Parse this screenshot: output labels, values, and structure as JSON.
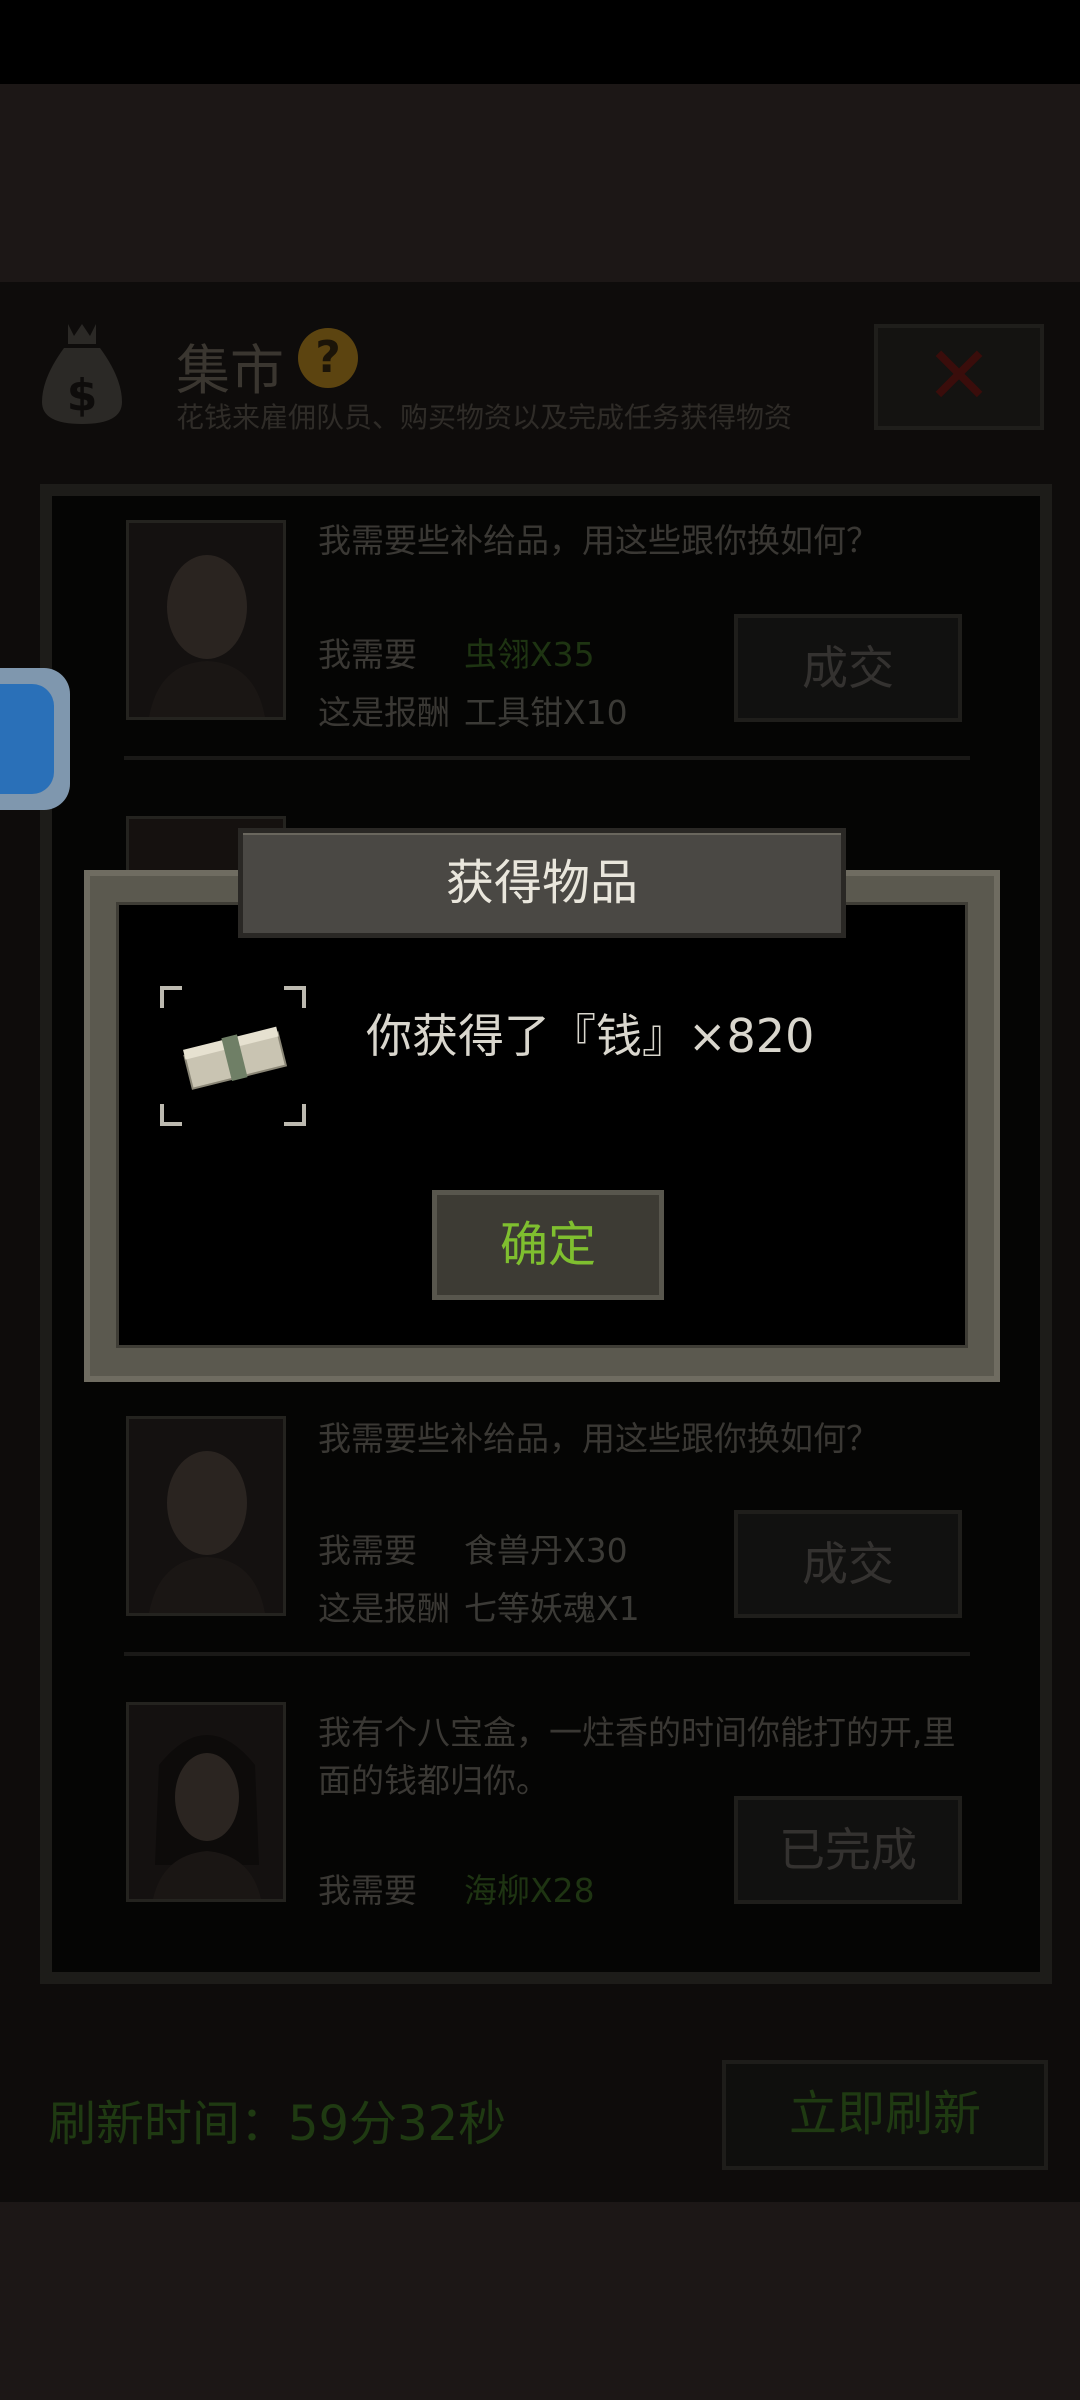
{
  "header": {
    "title": "集市",
    "subtitle": "花钱来雇佣队员、购买物资以及完成任务获得物资"
  },
  "trades": [
    {
      "message": "我需要些补给品，用这些跟你换如何？",
      "need_label": "我需要",
      "need_item": "虫翎X35",
      "reward_label": "这是报酬",
      "reward_item": "工具钳X10",
      "button": "成交"
    },
    {
      "message": "我需要些补给品，用这些跟你换如何？",
      "need_label": "我需要",
      "need_item": "食兽丹X30",
      "reward_label": "这是报酬",
      "reward_item": "七等妖魂X1",
      "button": "成交"
    },
    {
      "message_line1": "我有个八宝盒，一炷香的时间你能打的开,里",
      "message_line2": "面的钱都归你。",
      "need_label": "我需要",
      "need_item": "海柳X28",
      "button": "已完成"
    }
  ],
  "modal": {
    "title": "获得物品",
    "reward_text": "你获得了『钱』×820",
    "confirm": "确定"
  },
  "footer": {
    "refresh_label": "刷新时间：59分32秒",
    "refresh_button": "立即刷新"
  },
  "colors": {
    "accent_green": "#7fbf2f",
    "modal_text": "#e9e6dc"
  }
}
